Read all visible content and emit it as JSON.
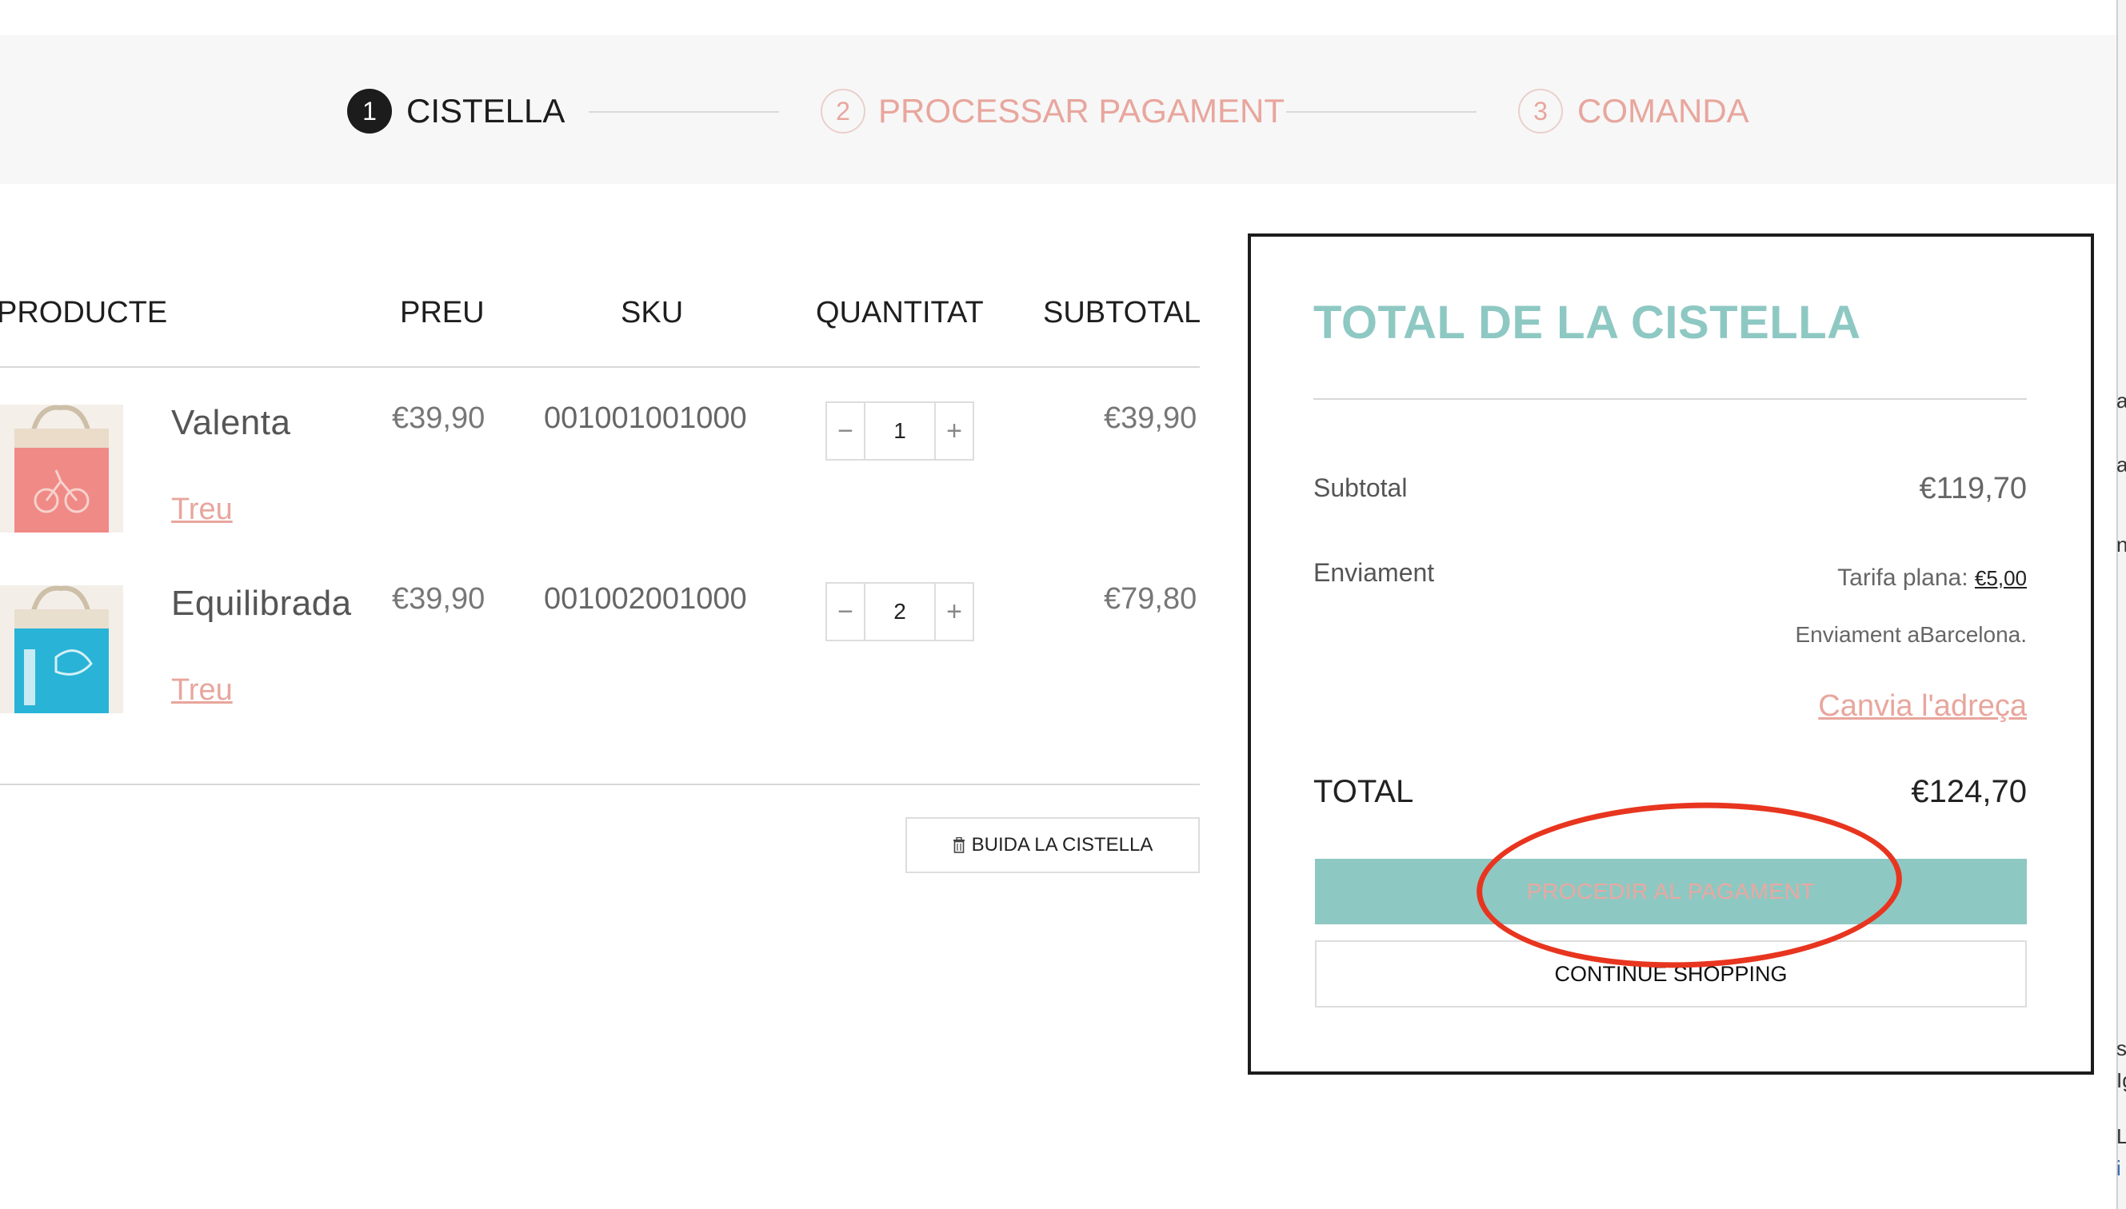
{
  "steps": [
    {
      "number": "1",
      "label": "CISTELLA",
      "state": "active"
    },
    {
      "number": "2",
      "label": "PROCESSAR PAGAMENT",
      "state": "inactive"
    },
    {
      "number": "3",
      "label": "COMANDA",
      "state": "inactive"
    }
  ],
  "cart": {
    "headers": {
      "product": "PRODUCTE",
      "price": "PREU",
      "sku": "SKU",
      "quantity": "QUANTITAT",
      "subtotal": "SUBTOTAL"
    },
    "items": [
      {
        "name": "Valenta",
        "remove_label": "Treu",
        "price": "€39,90",
        "sku": "001001001000",
        "quantity": "1",
        "subtotal": "€39,90",
        "image_color": "#f08a86"
      },
      {
        "name": "Equilibrada",
        "remove_label": "Treu",
        "price": "€39,90",
        "sku": "001002001000",
        "quantity": "2",
        "subtotal": "€79,80",
        "image_color": "#29b3d6"
      }
    ],
    "qty_minus_symbol": "−",
    "qty_plus_symbol": "+",
    "empty_cart_label": "BUIDA LA CISTELLA",
    "empty_cart_icon": "trash-icon"
  },
  "totals": {
    "title": "TOTAL DE LA CISTELLA",
    "subtotal_label": "Subtotal",
    "subtotal_value": "€119,70",
    "shipping_label": "Enviament",
    "shipping_method_label": "Tarifa plana:",
    "shipping_method_price": "€5,00",
    "shipping_destination": "Enviament aBarcelona.",
    "change_address_label": "Canvia l'adreça",
    "total_label": "TOTAL",
    "total_value": "€124,70",
    "checkout_label": "PROCEDIR AL PAGAMENT",
    "continue_label": "CONTINUE SHOPPING"
  },
  "colors": {
    "accent_teal": "#8ec8c3",
    "accent_pink": "#e8a69d",
    "annotation_red": "#e8351f"
  },
  "edge_fragments": [
    "a",
    "a",
    "n",
    "s",
    "Ig",
    "L",
    "i"
  ]
}
